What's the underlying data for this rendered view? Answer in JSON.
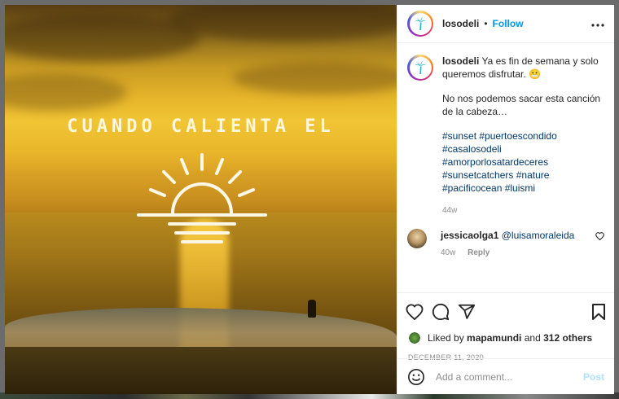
{
  "photo": {
    "overlay_text": "CUANDO CALIENTA EL"
  },
  "header": {
    "username": "losodeli",
    "separator": "•",
    "follow_label": "Follow",
    "more_icon": "more-options-icon"
  },
  "caption": {
    "username": "losodeli",
    "line1": "Ya es fin de semana y solo queremos disfrutar. 😬",
    "line2": "No nos podemos sacar esta canción de la cabeza…",
    "hashtags": "#sunset #puertoescondido #casalosodeli #amorporlosatardeceres #sunsetcatchers #nature #pacificocean #luismi",
    "time": "44w"
  },
  "comments": [
    {
      "username": "jessicaolga1",
      "mention": "@luisamoraleida",
      "time": "40w",
      "reply_label": "Reply"
    }
  ],
  "actions": {
    "liked_by_prefix": "Liked by",
    "liked_by_user": "mapamundi",
    "and": "and",
    "others": "312 others",
    "date": "DECEMBER 11, 2020"
  },
  "add_comment": {
    "placeholder": "Add a comment...",
    "post_label": "Post"
  },
  "colors": {
    "link_blue": "#0095f6",
    "hashtag_blue": "#00376b",
    "muted": "#8e8e8e",
    "post_disabled": "#b2dffc"
  }
}
